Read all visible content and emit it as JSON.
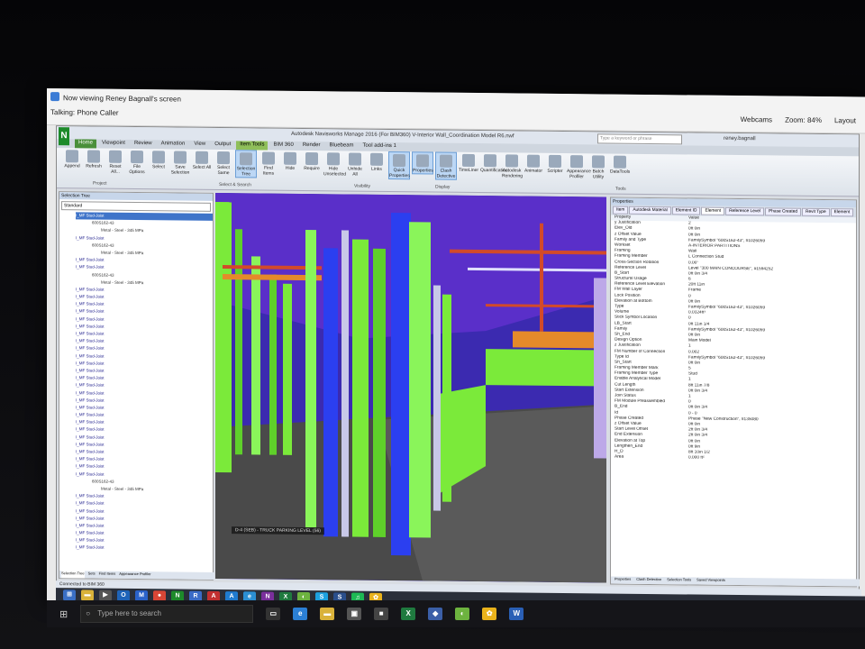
{
  "share_bar": {
    "title": "Now viewing Reney Bagnall's screen",
    "talking": "Talking: Phone Caller",
    "webcams": "Webcams",
    "zoom": "Zoom: 84%",
    "layout": "Layout"
  },
  "app": {
    "window_title": "Autodesk Navisworks Manage 2016 (For BIM360)    V-Interior Wall_Coordination Model R6.nwf",
    "search_placeholder": "Type a keyword or phrase",
    "user": "reney.bagnall",
    "tabs": [
      "Home",
      "Viewpoint",
      "Review",
      "Animation",
      "View",
      "Output",
      "Item Tools",
      "BIM 360",
      "Render",
      "Bluebeam",
      "Tool add-ins 1"
    ],
    "ribbon_buttons": [
      "Append",
      "Refresh",
      "Reset All...",
      "File Options",
      "Select",
      "Save Selection",
      "Select All",
      "Select Same",
      "Selection Tree",
      "Find Items",
      "Hide",
      "Require",
      "Hide Unselected",
      "Unhide All",
      "Links",
      "Quick Properties",
      "Properties",
      "Clash Detective",
      "TimeLiner",
      "Quantification",
      "Autodesk Rendering",
      "Animator",
      "Scripter",
      "Appearance Profiler",
      "Batch Utility",
      "DataTools"
    ],
    "ribbon_groups": [
      "Project",
      "Select & Search",
      "Visibility",
      "Display",
      "Tools"
    ]
  },
  "selection_tree": {
    "header": "Selection Tree",
    "mode": "Standard",
    "items": [
      {
        "level": 1,
        "text": "I_MF Stud-Joist",
        "selected": true
      },
      {
        "level": 2,
        "text": "600S162-43"
      },
      {
        "level": 3,
        "text": "Metal - Steel - 345 MPa"
      },
      {
        "level": 1,
        "text": "I_MF Stud-Joist"
      },
      {
        "level": 2,
        "text": "600S162-43"
      },
      {
        "level": 3,
        "text": "Metal - Steel - 345 MPa"
      },
      {
        "level": 1,
        "text": "I_MF Stud-Joist"
      },
      {
        "level": 1,
        "text": "I_MF Stud-Joist"
      },
      {
        "level": 2,
        "text": "600S162-43"
      },
      {
        "level": 3,
        "text": "Metal - Steel - 345 MPa"
      },
      {
        "level": 1,
        "text": "I_MF Stud-Joist"
      },
      {
        "level": 1,
        "text": "I_MF Stud-Joist"
      },
      {
        "level": 1,
        "text": "I_MF Stud-Joist"
      },
      {
        "level": 1,
        "text": "I_MF Stud-Joist"
      },
      {
        "level": 1,
        "text": "I_MF Stud-Joist"
      },
      {
        "level": 1,
        "text": "I_MF Stud-Joist"
      },
      {
        "level": 1,
        "text": "I_MF Stud-Joist"
      },
      {
        "level": 1,
        "text": "I_MF Stud-Joist"
      },
      {
        "level": 1,
        "text": "I_MF Stud-Joist"
      },
      {
        "level": 1,
        "text": "I_MF Stud-Joist"
      },
      {
        "level": 1,
        "text": "I_MF Stud-Joist"
      },
      {
        "level": 1,
        "text": "I_MF Stud-Joist"
      },
      {
        "level": 1,
        "text": "I_MF Stud-Joist"
      },
      {
        "level": 1,
        "text": "I_MF Stud-Joist"
      },
      {
        "level": 1,
        "text": "I_MF Stud-Joist"
      },
      {
        "level": 1,
        "text": "I_MF Stud-Joist"
      },
      {
        "level": 1,
        "text": "I_MF Stud-Joist"
      },
      {
        "level": 1,
        "text": "I_MF Stud-Joist"
      },
      {
        "level": 1,
        "text": "I_MF Stud-Joist"
      },
      {
        "level": 1,
        "text": "I_MF Stud-Joist"
      },
      {
        "level": 1,
        "text": "I_MF Stud-Joist"
      },
      {
        "level": 1,
        "text": "I_MF Stud-Joist"
      },
      {
        "level": 1,
        "text": "I_MF Stud-Joist"
      },
      {
        "level": 1,
        "text": "I_MF Stud-Joist"
      },
      {
        "level": 1,
        "text": "I_MF Stud-Joist"
      },
      {
        "level": 1,
        "text": "I_MF Stud-Joist"
      },
      {
        "level": 2,
        "text": "600S162-43"
      },
      {
        "level": 3,
        "text": "Metal - Steel - 345 MPa"
      },
      {
        "level": 1,
        "text": "I_MF Stud-Joist"
      },
      {
        "level": 1,
        "text": "I_MF Stud-Joist"
      },
      {
        "level": 1,
        "text": "I_MF Stud-Joist"
      },
      {
        "level": 1,
        "text": "I_MF Stud-Joist"
      },
      {
        "level": 1,
        "text": "I_MF Stud-Joist"
      },
      {
        "level": 1,
        "text": "I_MF Stud-Joist"
      },
      {
        "level": 1,
        "text": "I_MF Stud-Joist"
      },
      {
        "level": 1,
        "text": "I_MF Stud-Joist"
      }
    ],
    "bottom_tabs": [
      "Selection Tree",
      "Sets",
      "Find Items",
      "Appearance Profiler"
    ]
  },
  "viewport": {
    "level_label": "D-4 (SEB) - TRUCK PARKING LEVEL (56)"
  },
  "properties": {
    "header": "Properties",
    "tabs": [
      "Item",
      "Autodesk Material",
      "Element ID",
      "Element",
      "Reference Level",
      "Phase Created",
      "Revit Type",
      "Element"
    ],
    "columns": [
      "Property",
      "Value"
    ],
    "rows": [
      [
        "y Justification",
        "2"
      ],
      [
        "Elev_Old",
        "0ft 0in"
      ],
      [
        "z Offset Value",
        "0ft 0in"
      ],
      [
        "Family and Type",
        "FamilySymbol \"600S162-43\", #1026059"
      ],
      [
        "Workset",
        "A-INTERIOR PARTITIONS"
      ],
      [
        "Framing",
        "Wall"
      ],
      [
        "Framing Member",
        "L Connection Stud"
      ],
      [
        "Cross-Section Rotation",
        "0.00°"
      ],
      [
        "Reference Level",
        "Level \"300 MAIN CONCOURSE\", #1594252"
      ],
      [
        "B_Start",
        "0ft 0in 3/4"
      ],
      [
        "Structural Usage",
        "6"
      ],
      [
        "Reference Level Elevation",
        "20ft 11in"
      ],
      [
        "FM Wall Layer",
        "Frame"
      ],
      [
        "Lock Position",
        "0"
      ],
      [
        "Elevation at Bottom",
        "0ft 0in"
      ],
      [
        "Type",
        "FamilySymbol \"600S162-43\", #1026059"
      ],
      [
        "Volume",
        "0.0324ft³"
      ],
      [
        "Stick Symbol Location",
        "0"
      ],
      [
        "LB_Start",
        "0ft 11in 1/4"
      ],
      [
        "Family",
        "FamilySymbol \"600S162-43\", #1026059"
      ],
      [
        "Sh_End",
        "0ft 0in"
      ],
      [
        "Design Option",
        "Main Model"
      ],
      [
        "z Justification",
        "1"
      ],
      [
        "FM Number of Connection",
        "0.002"
      ],
      [
        "Type Id",
        "FamilySymbol \"600S162-43\", #1026059"
      ],
      [
        "Sh_Start",
        "0ft 0in"
      ],
      [
        "Framing Member Mark",
        "5"
      ],
      [
        "Framing Member Type",
        "Stud"
      ],
      [
        "Enable Analytical Model",
        "1"
      ],
      [
        "Cut Length",
        "8ft 11in 7/8"
      ],
      [
        "Start Extension",
        "0ft 0in 3/4"
      ],
      [
        "Join Status",
        "1"
      ],
      [
        "FM Module Preassembled",
        "0"
      ],
      [
        "B_End",
        "0ft 0in 3/4"
      ],
      [
        "Id",
        "0 - 0"
      ],
      [
        "Phase Created",
        "Phase \"New Construction\", #135080"
      ],
      [
        "z Offset Value",
        "0ft 0in"
      ],
      [
        "Start Level Offset",
        "2ft 0in 3/4"
      ],
      [
        "End Extension",
        "2ft 0in 3/4"
      ],
      [
        "Elevation at Top",
        "0ft 0in"
      ],
      [
        "Lengthen_End",
        "0ft 9in"
      ],
      [
        "H_D",
        "8ft 10in 1/2"
      ],
      [
        "Area",
        "0.000 ft²"
      ]
    ],
    "bottom_tabs": [
      "Properties",
      "Clash Detective",
      "Selection Tools",
      "Saved Viewpoints"
    ]
  },
  "status": {
    "connection": "Connected to BIM 360"
  },
  "inner_taskbar": {
    "icons": [
      {
        "name": "windows-icon",
        "glyph": "⊞",
        "color": "#3a6fc4"
      },
      {
        "name": "explorer-icon",
        "glyph": "▬",
        "color": "#d9b23a"
      },
      {
        "name": "media-icon",
        "glyph": "▶",
        "color": "#555"
      },
      {
        "name": "outlook-icon",
        "glyph": "O",
        "color": "#1e63b8"
      },
      {
        "name": "m-app-icon",
        "glyph": "M",
        "color": "#2a62c9"
      },
      {
        "name": "chrome-icon",
        "glyph": "●",
        "color": "#d84636"
      },
      {
        "name": "navisworks-icon",
        "glyph": "N",
        "color": "#1d8a2a"
      },
      {
        "name": "revit-icon",
        "glyph": "R",
        "color": "#3b6bc7"
      },
      {
        "name": "autocad-icon",
        "glyph": "A",
        "color": "#c23030"
      },
      {
        "name": "bim-icon",
        "glyph": "A",
        "color": "#1f7bd0"
      },
      {
        "name": "ie-icon",
        "glyph": "e",
        "color": "#2b8fd4"
      },
      {
        "name": "onenote-icon",
        "glyph": "N",
        "color": "#7a2f9c"
      },
      {
        "name": "excel-icon",
        "glyph": "X",
        "color": "#1f7a3f"
      },
      {
        "name": "app-green-icon",
        "glyph": "◐",
        "color": "#6db33f"
      },
      {
        "name": "skype-icon",
        "glyph": "S",
        "color": "#1da1e0"
      },
      {
        "name": "s-app-icon",
        "glyph": "S",
        "color": "#2a4f8c"
      },
      {
        "name": "spotify-icon",
        "glyph": "♫",
        "color": "#1db954"
      },
      {
        "name": "flower-icon",
        "glyph": "✿",
        "color": "#e9b21b"
      }
    ]
  },
  "outer_taskbar": {
    "search_placeholder": "Type here to search",
    "icons": [
      {
        "name": "task-view-icon",
        "glyph": "▭",
        "color": "#333"
      },
      {
        "name": "edge-icon",
        "glyph": "e",
        "color": "#2b7fd4"
      },
      {
        "name": "file-explorer-icon",
        "glyph": "▬",
        "color": "#d9b23a"
      },
      {
        "name": "store-icon",
        "glyph": "▣",
        "color": "#555"
      },
      {
        "name": "app-square-icon",
        "glyph": "■",
        "color": "#444"
      },
      {
        "name": "excel-icon",
        "glyph": "X",
        "color": "#1f7a3f"
      },
      {
        "name": "profile-icon",
        "glyph": "◆",
        "color": "#3b5fa8"
      },
      {
        "name": "app-green-icon",
        "glyph": "◐",
        "color": "#6db33f"
      },
      {
        "name": "flower-icon",
        "glyph": "✿",
        "color": "#e9b21b"
      },
      {
        "name": "word-icon",
        "glyph": "W",
        "color": "#2a5fb5"
      }
    ]
  }
}
